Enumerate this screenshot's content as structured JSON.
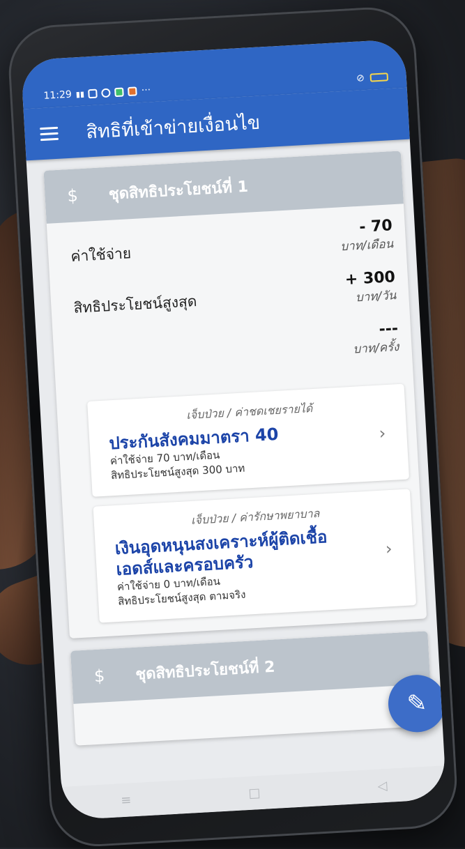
{
  "status": {
    "time": "11:29",
    "signal": "ℹ░",
    "more": "···"
  },
  "appbar": {
    "title": "สิทธิที่เข้าข่ายเงื่อนไข"
  },
  "cards": [
    {
      "title": "ชุดสิทธิประโยชน์ที่ 1",
      "rows": [
        {
          "label": "ค่าใช้จ่าย",
          "value": "- 70",
          "unit": "บาท/เดือน"
        },
        {
          "label": "สิทธิประโยชน์สูงสุด",
          "value": "+ 300",
          "unit": "บาท/วัน"
        },
        {
          "label": "",
          "value": "---",
          "unit": "บาท/ครั้ง"
        }
      ],
      "items": [
        {
          "category": "เจ็บป่วย / ค่าชดเชยรายได้",
          "title": "ประกันสังคมมาตรา 40",
          "line1": "ค่าใช้จ่าย 70 บาท/เดือน",
          "line2": "สิทธิประโยชน์สูงสุด 300 บาท"
        },
        {
          "category": "เจ็บป่วย / ค่ารักษาพยาบาล",
          "title": "เงินอุดหนุนสงเคราะห์ผู้ติดเชื้อเอดส์และครอบครัว",
          "line1": "ค่าใช้จ่าย 0 บาท/เดือน",
          "line2": "สิทธิประโยชน์สูงสุด ตามจริง"
        }
      ]
    },
    {
      "title": "ชุดสิทธิประโยชน์ที่ 2"
    }
  ],
  "icons": {
    "dollar": "$",
    "chevron": "›",
    "fab": "✎"
  },
  "nav": {
    "menu": "≡",
    "home": "□",
    "back": "◁"
  },
  "colors": {
    "primary": "#2f66c4",
    "title_blue": "#1c44a8",
    "header_gray": "#bcc4cc"
  }
}
